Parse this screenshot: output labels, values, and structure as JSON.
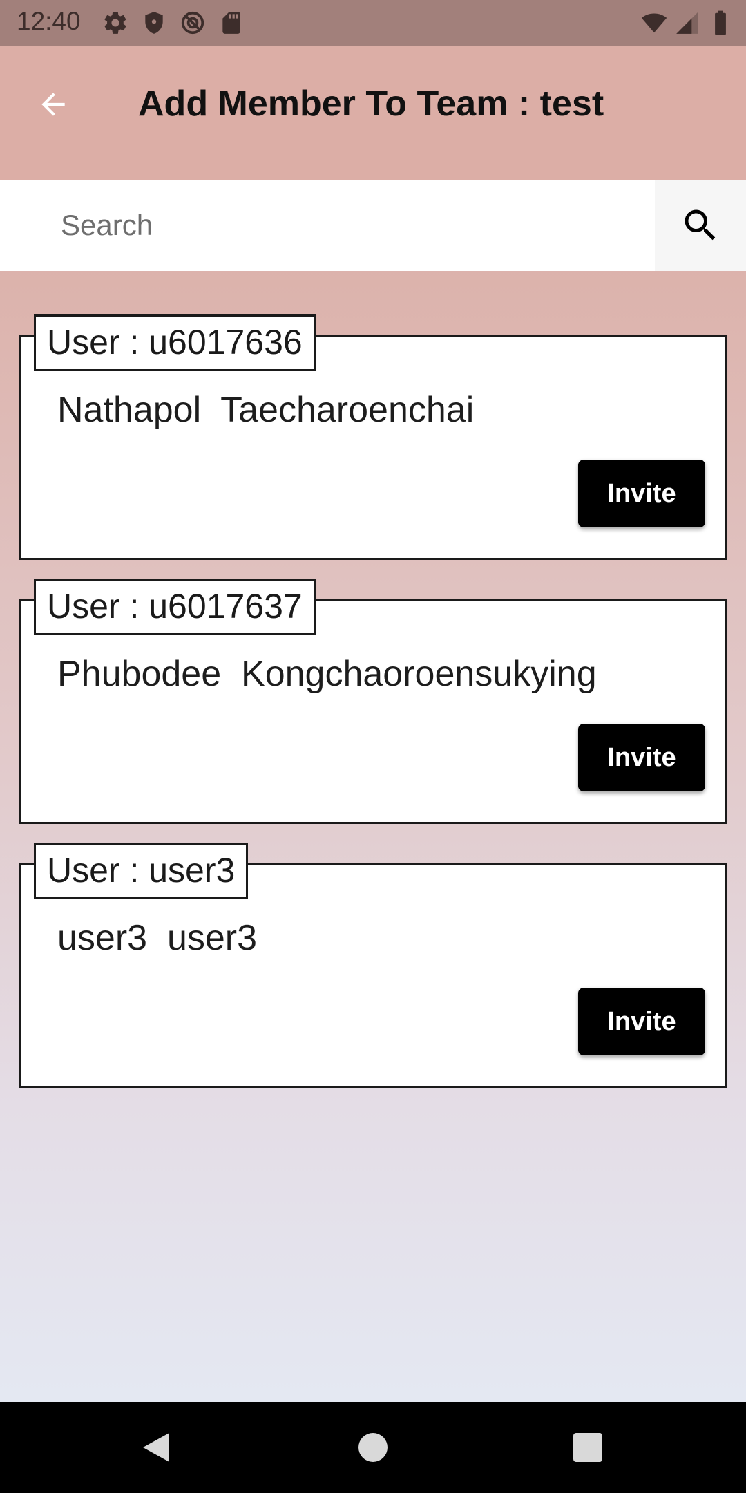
{
  "status_bar": {
    "time": "12:40",
    "left_icons": [
      "settings-icon",
      "shield-icon",
      "data-saver-icon",
      "sd-card-icon"
    ],
    "right_icons": [
      "wifi-icon",
      "signal-icon",
      "battery-icon"
    ]
  },
  "app_bar": {
    "title": "Add Member To Team : test",
    "back_icon": "arrow-back-icon",
    "background": "#dcaea6"
  },
  "search": {
    "placeholder": "Search",
    "value": "",
    "button_icon": "search-icon"
  },
  "users": [
    {
      "legend": "User : u6017636",
      "full_name": "Nathapol  Taecharoenchai",
      "action_label": "Invite"
    },
    {
      "legend": "User : u6017637",
      "full_name": "Phubodee  Kongchaoroensukying",
      "action_label": "Invite"
    },
    {
      "legend": "User : user3",
      "full_name": "user3  user3",
      "action_label": "Invite"
    }
  ],
  "nav_bar": {
    "buttons": [
      "back-nav-icon",
      "home-nav-icon",
      "recents-nav-icon"
    ]
  },
  "colors": {
    "status_bar": "#a2807b",
    "app_bar": "#dcaea6",
    "button": "#000000",
    "button_text": "#ffffff"
  }
}
